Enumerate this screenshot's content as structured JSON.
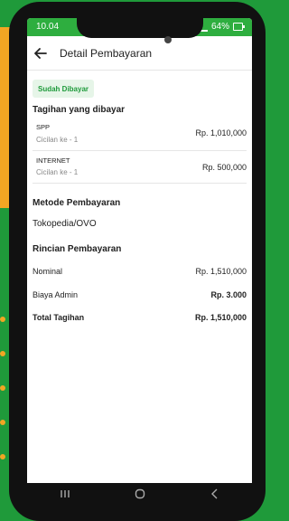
{
  "status_bar": {
    "time": "10.04",
    "battery": "64%"
  },
  "header": {
    "title": "Detail Pembayaran",
    "back_icon": "arrow-left-icon"
  },
  "badge": {
    "label": "Sudah Dibayar"
  },
  "bills": {
    "section_title": "Tagihan yang dibayar",
    "items": [
      {
        "name": "SPP",
        "installment": "Cicilan ke - 1",
        "amount": "Rp. 1,010,000"
      },
      {
        "name": "INTERNET",
        "installment": "Cicilan ke - 1",
        "amount": "Rp. 500,000"
      }
    ]
  },
  "payment_method": {
    "section_title": "Metode Pembayaran",
    "value": "Tokopedia/OVO"
  },
  "details": {
    "section_title": "Rincian Pembayaran",
    "rows": [
      {
        "label": "Nominal",
        "value": "Rp. 1,510,000"
      },
      {
        "label": "Biaya Admin",
        "value": "Rp. 3.000"
      },
      {
        "label": "Total Tagihan",
        "value": "Rp. 1,510,000"
      }
    ]
  },
  "colors": {
    "accent_green": "#2eae3f",
    "badge_bg": "#e6f5e8",
    "background": "#1f9a3a",
    "orange": "#f2a623"
  },
  "nav": {
    "icons": [
      "recent-apps-icon",
      "home-icon",
      "back-nav-icon"
    ]
  }
}
